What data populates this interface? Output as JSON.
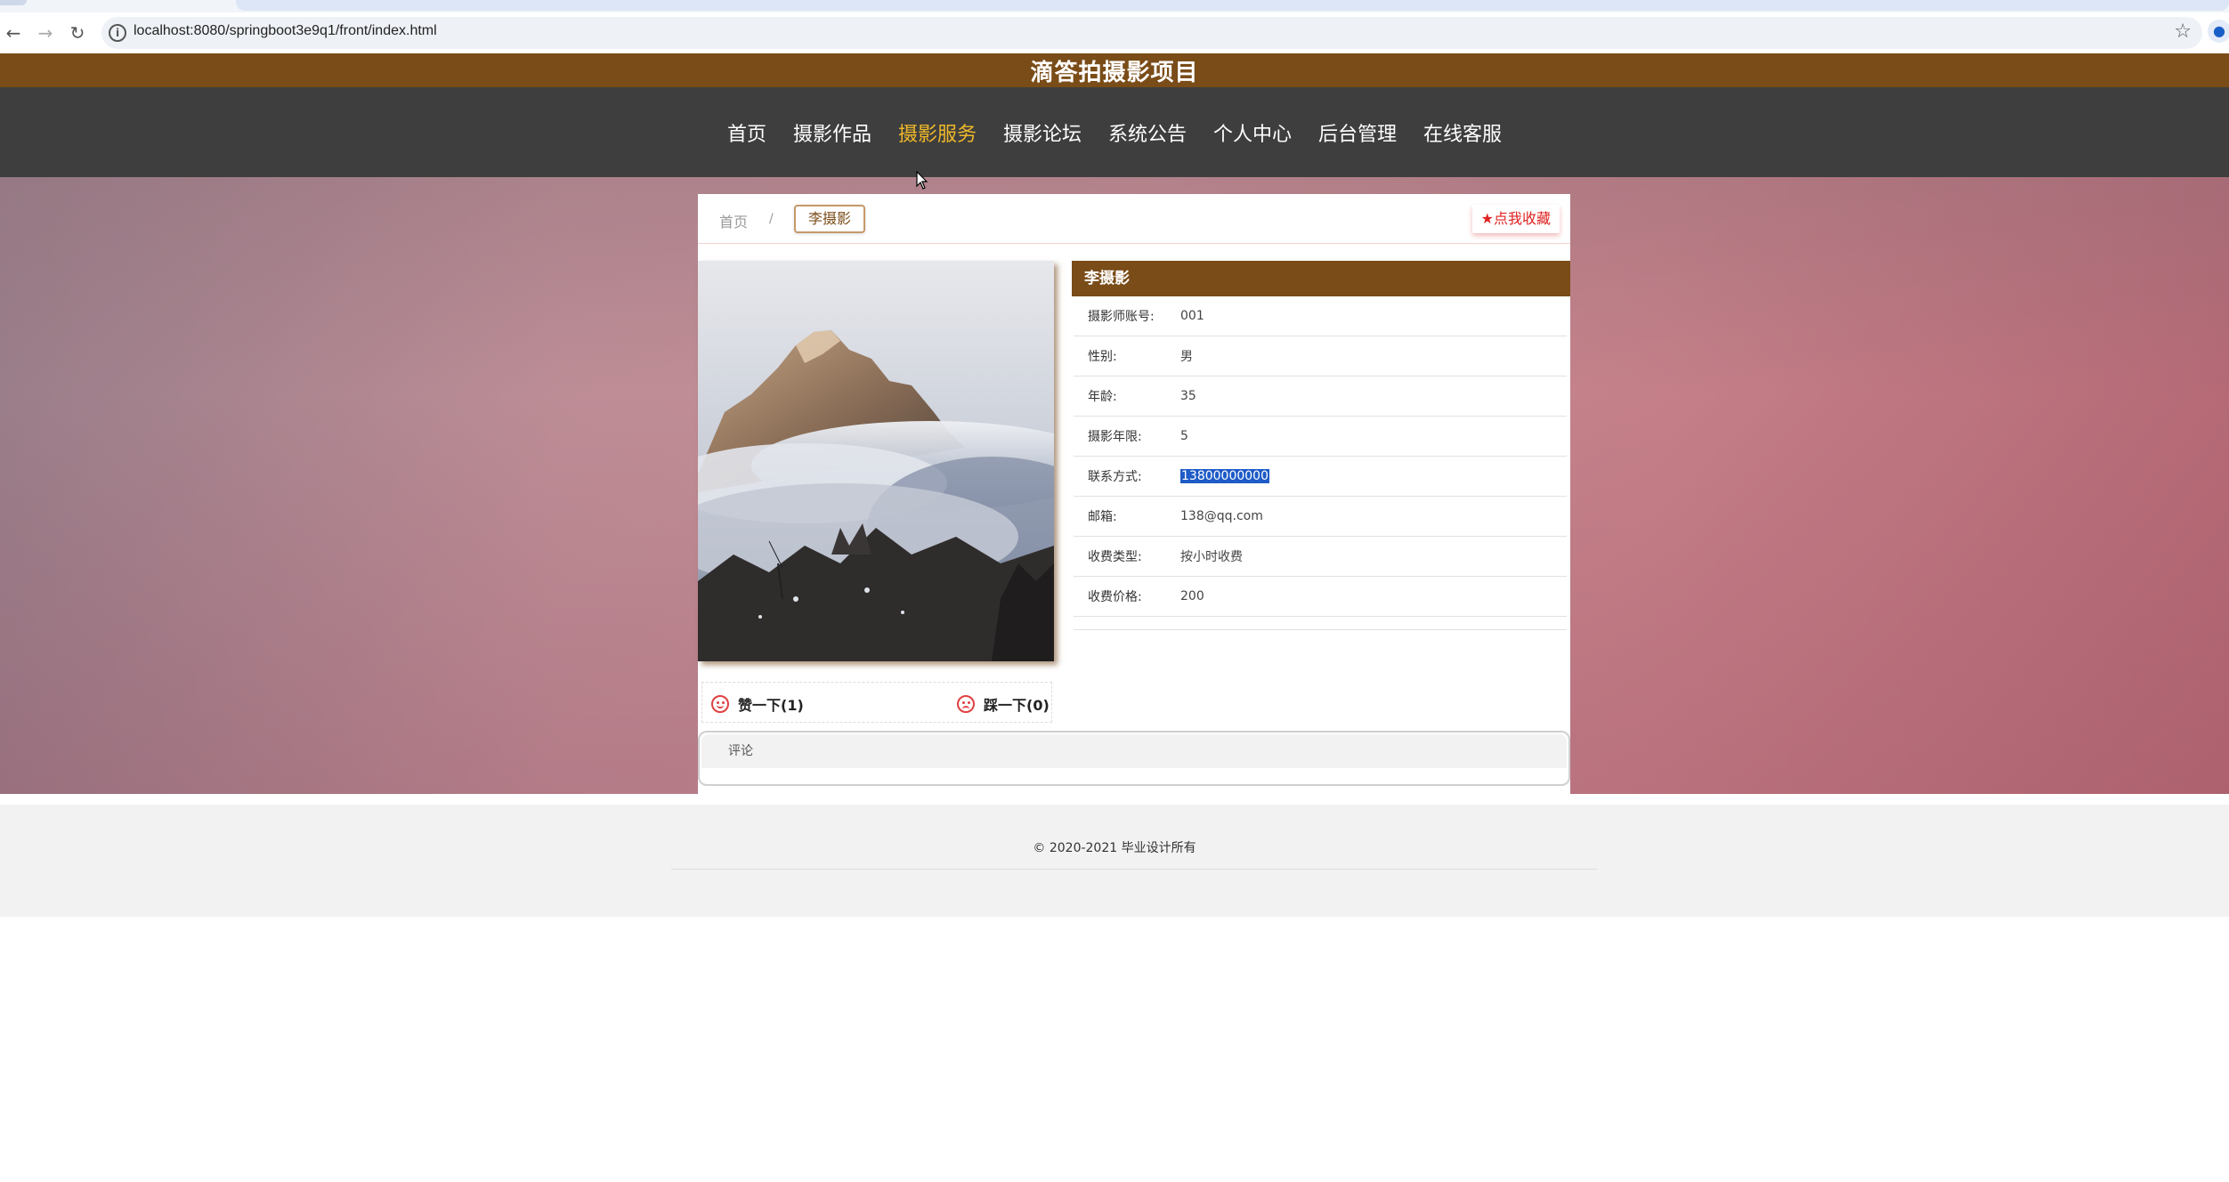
{
  "browser": {
    "url": "localhost:8080/springboot3e9q1/front/index.html",
    "back_icon": "←",
    "forward_icon": "→",
    "reload_icon": "↻",
    "star_icon": "☆",
    "info_icon": "i",
    "profile_icon": "●"
  },
  "site": {
    "title": "滴答拍摄影项目"
  },
  "nav": {
    "items": [
      {
        "label": "首页"
      },
      {
        "label": "摄影作品"
      },
      {
        "label": "摄影服务"
      },
      {
        "label": "摄影论坛"
      },
      {
        "label": "系统公告"
      },
      {
        "label": "个人中心"
      },
      {
        "label": "后台管理"
      },
      {
        "label": "在线客服"
      }
    ],
    "active_color": "#f0b829"
  },
  "breadcrumb": {
    "home": "首页",
    "separator": "/",
    "current": "李摄影"
  },
  "favorite": {
    "label": "★点我收藏"
  },
  "detail": {
    "title": "李摄影",
    "rows": [
      {
        "key": "摄影师账号:",
        "value": "001"
      },
      {
        "key": "性别:",
        "value": "男"
      },
      {
        "key": "年龄:",
        "value": "35"
      },
      {
        "key": "摄影年限:",
        "value": "5"
      },
      {
        "key": "联系方式:",
        "value": "13800000000"
      },
      {
        "key": "邮箱:",
        "value": "138@qq.com"
      },
      {
        "key": "收费类型:",
        "value": "按小时收费"
      },
      {
        "key": "收费价格:",
        "value": "200"
      }
    ]
  },
  "reactions": {
    "like": "赞一下(1)",
    "dislike": "踩一下(0)"
  },
  "comment": {
    "title": "评论"
  },
  "footer": {
    "copyright": "© 2020-2021 毕业设计所有"
  },
  "colors": {
    "header_brown": "#7a4c18",
    "nav_dark": "#3e3e3e"
  }
}
